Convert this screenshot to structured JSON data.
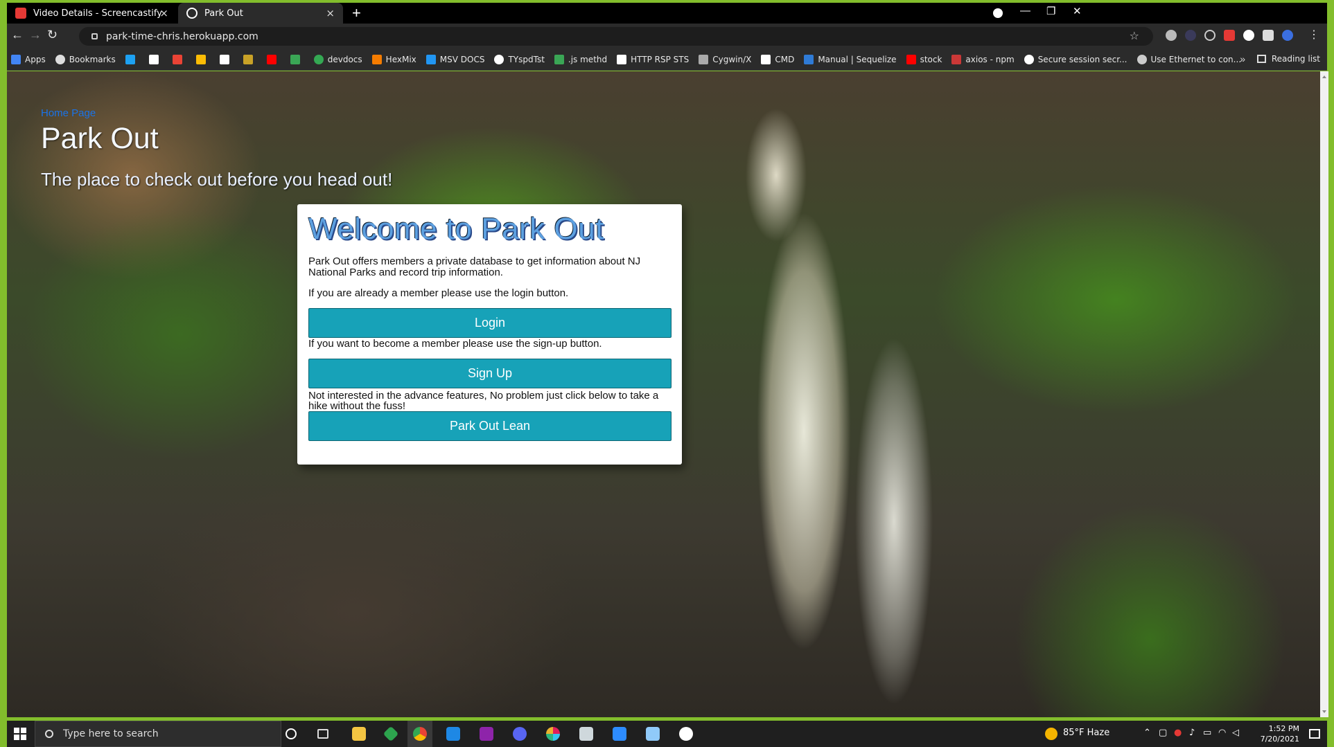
{
  "browser": {
    "tabs": [
      {
        "title": "Video Details - Screencastify",
        "close": "×"
      },
      {
        "title": "Park Out",
        "close": "×"
      }
    ],
    "new_tab": "+",
    "window_controls": {
      "minimize": "—",
      "restore": "❐",
      "close": "✕"
    },
    "nav": {
      "back": "←",
      "forward": "→",
      "reload": "↻"
    },
    "url": "park-time-chris.herokuapp.com",
    "star": "☆"
  },
  "bookmarks": [
    {
      "label": "Apps",
      "color": "#4285f4"
    },
    {
      "label": "Bookmarks",
      "color": "#dddddd"
    },
    {
      "label": "",
      "color": "#1da1f2"
    },
    {
      "label": "",
      "color": "#ffffff"
    },
    {
      "label": "",
      "color": "#ea4335"
    },
    {
      "label": "",
      "color": "#fbbc05"
    },
    {
      "label": "",
      "color": "#ffffff"
    },
    {
      "label": "",
      "color": "#c9a227"
    },
    {
      "label": "",
      "color": "#ff0000"
    },
    {
      "label": "",
      "color": "#3aa655"
    },
    {
      "label": "devdocs",
      "color": "#34a853"
    },
    {
      "label": "HexMix",
      "color": "#f57c00"
    },
    {
      "label": "MSV DOCS",
      "color": "#2196f3"
    },
    {
      "label": "TYspdTst",
      "color": "#ffffff"
    },
    {
      "label": ".js methd",
      "color": "#3aa655"
    },
    {
      "label": "HTTP RSP STS",
      "color": "#ffffff"
    },
    {
      "label": "Cygwin/X",
      "color": "#aaaaaa"
    },
    {
      "label": "CMD",
      "color": "#ffffff"
    },
    {
      "label": "Manual | Sequelize",
      "color": "#2f7bd6"
    },
    {
      "label": "stock",
      "color": "#ff0000"
    },
    {
      "label": "axios - npm",
      "color": "#cb3837"
    },
    {
      "label": "Secure session secr...",
      "color": "#ffffff"
    },
    {
      "label": "Use Ethernet to con...",
      "color": "#cccccc"
    }
  ],
  "bookmarks_more": "»",
  "reading_list": "Reading list",
  "page": {
    "home_link": "Home Page",
    "site_title": "Park Out",
    "tagline": "The place to check out before you head out!",
    "card": {
      "title": "Welcome to Park Out",
      "intro": "Park Out offers members a private database to get information about NJ National Parks and record trip information.",
      "login_prompt": "If you are already a member please use the login button.",
      "login_button": "Login",
      "signup_prompt": "If you want to become a member please use the sign-up button.",
      "signup_button": "Sign Up",
      "lean_prompt": "Not interested in the advance features, No problem just click below to take a hike without the fuss!",
      "lean_button": "Park Out Lean"
    }
  },
  "taskbar": {
    "search_placeholder": "Type here to search",
    "weather": "85°F  Haze",
    "time": "1:52 PM",
    "date": "7/20/2021"
  }
}
